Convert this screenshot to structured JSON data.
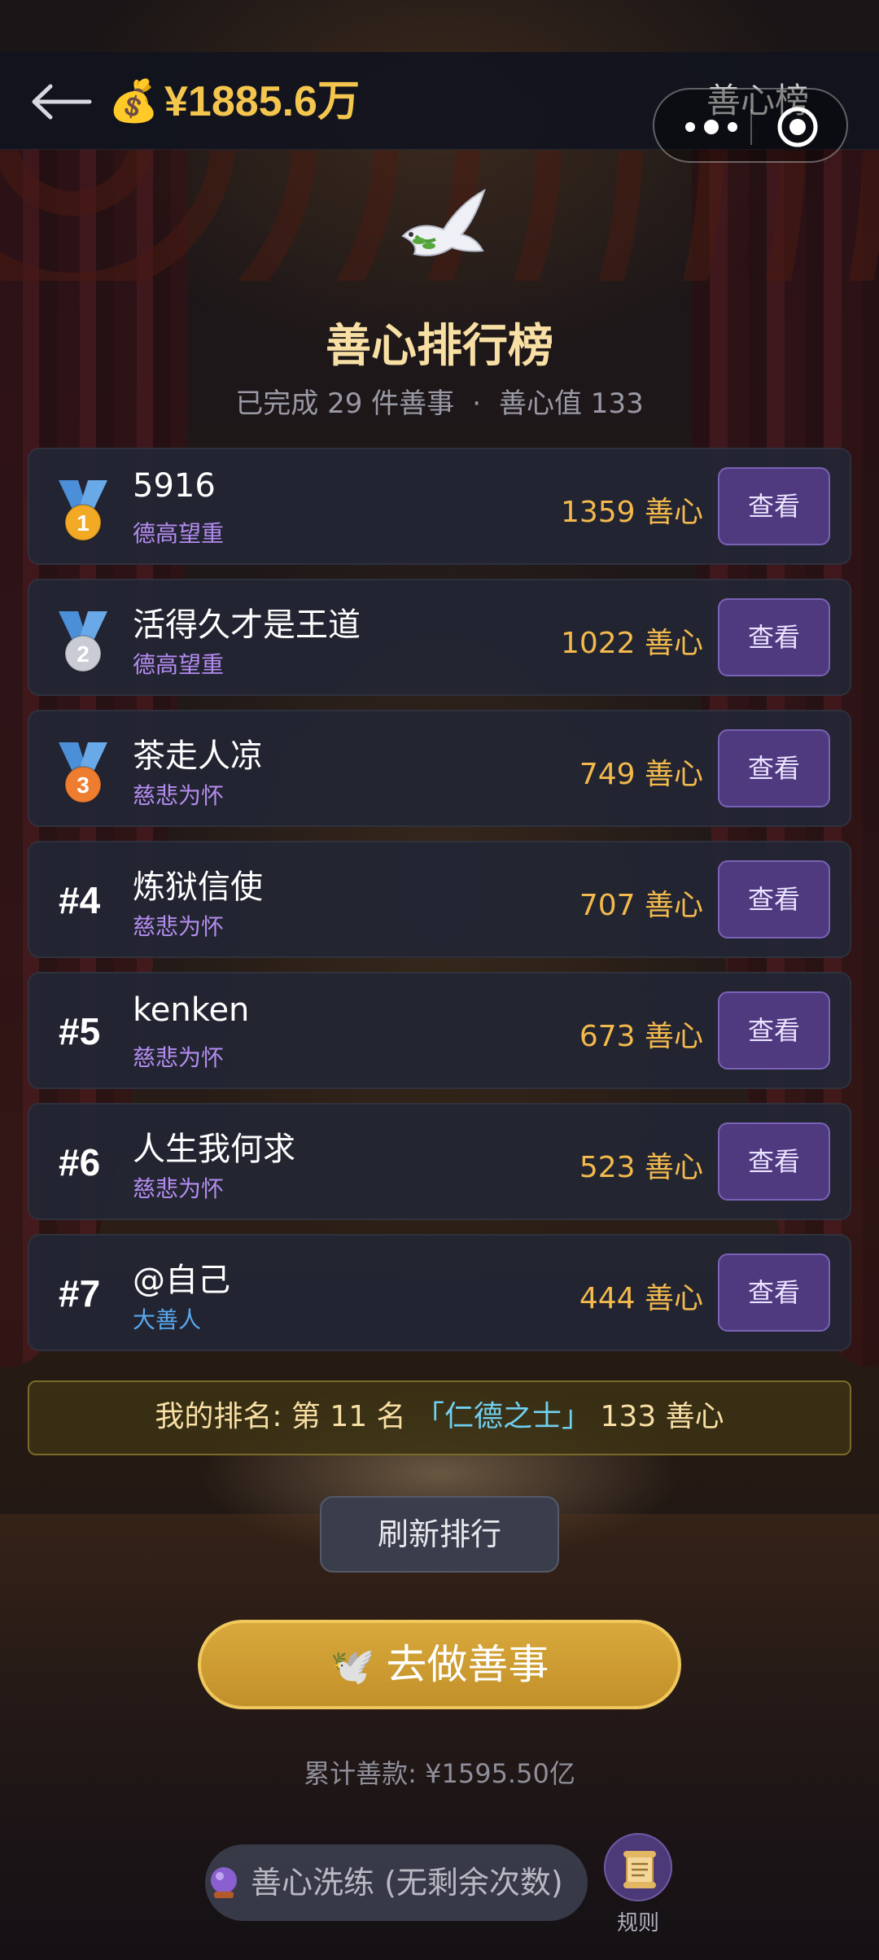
{
  "header": {
    "balance": "¥1885.6万",
    "page_label": "善心榜",
    "money_icon": "💰",
    "dove_icon": "🕊️"
  },
  "hero": {
    "title": "善心排行榜",
    "completed_text": "已完成 29 件善事",
    "separator": "·",
    "kindness_text": "善心值 133"
  },
  "leaderboard": [
    {
      "rank": "#1",
      "medal": "1",
      "name": "5916",
      "title": "德高望重",
      "score": "1359 善心",
      "button": "查看"
    },
    {
      "rank": "#2",
      "medal": "2",
      "name": "活得久才是王道",
      "title": "德高望重",
      "score": "1022 善心",
      "button": "查看"
    },
    {
      "rank": "#3",
      "medal": "3",
      "name": "茶走人凉",
      "title": "慈悲为怀",
      "score": "749 善心",
      "button": "查看"
    },
    {
      "rank": "#4",
      "name": "炼狱信使",
      "title": "慈悲为怀",
      "score": "707 善心",
      "button": "查看"
    },
    {
      "rank": "#5",
      "name": "kenken",
      "title": "慈悲为怀",
      "score": "673 善心",
      "button": "查看"
    },
    {
      "rank": "#6",
      "name": "人生我何求",
      "title": "慈悲为怀",
      "score": "523 善心",
      "button": "查看"
    },
    {
      "rank": "#7",
      "name": "@自己",
      "title": "大善人",
      "score": "444 善心",
      "button": "查看"
    }
  ],
  "colors": {
    "title_purple": "#b48cf0",
    "title_blue": "#5aa8f0",
    "gold": "#f3b94c",
    "medal_gold": "#f2a923",
    "medal_silver": "#c9ccd4",
    "medal_bronze": "#ee7d2f",
    "ribbon": "#4a8fd8"
  },
  "my_rank": {
    "prefix": "我的排名: 第 11 名",
    "honor": "「仁德之士」",
    "score": "133 善心"
  },
  "actions": {
    "refresh": "刷新排行",
    "do_good": "去做善事",
    "total_donation": "累计善款: ¥1595.50亿",
    "refine": "善心洗练 (无剩余次数)",
    "rules": "规则"
  }
}
